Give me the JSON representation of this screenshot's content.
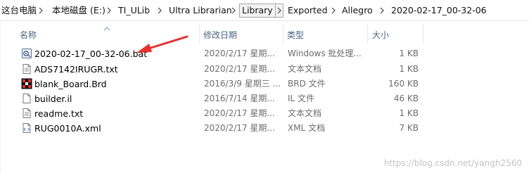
{
  "breadcrumb": [
    {
      "label": "这台电脑"
    },
    {
      "label": "本地磁盘 (E:)"
    },
    {
      "label": "TI_ULib"
    },
    {
      "label": "Ultra Librarian"
    },
    {
      "label": "Library"
    },
    {
      "label": "Exported"
    },
    {
      "label": "Allegro"
    },
    {
      "label": "2020-02-17_00-32-06"
    }
  ],
  "columns": {
    "name": "名称",
    "date": "修改日期",
    "type": "类型",
    "size": "大小"
  },
  "files": [
    {
      "name": "2020-02-17_00-32-06.bat",
      "date": "2020/2/17 星期...",
      "type": "Windows 批处理...",
      "size": "1 KB",
      "icon": "batch-file-icon"
    },
    {
      "name": "ADS7142IRUGR.txt",
      "date": "2020/2/17 星期...",
      "type": "文本文档",
      "size": "1 KB",
      "icon": "text-file-icon"
    },
    {
      "name": "blank_Board.Brd",
      "date": "2016/3/9 星期三 ...",
      "type": "BRD 文件",
      "size": "160 KB",
      "icon": "brd-file-icon"
    },
    {
      "name": "builder.il",
      "date": "2016/7/14 星期...",
      "type": "IL 文件",
      "size": "46 KB",
      "icon": "generic-file-icon"
    },
    {
      "name": "readme.txt",
      "date": "2020/2/17 星期...",
      "type": "文本文档",
      "size": "1 KB",
      "icon": "text-file-icon"
    },
    {
      "name": "RUG0010A.xml",
      "date": "2020/2/17 星期...",
      "type": "XML 文档",
      "size": "7 KB",
      "icon": "xml-file-icon"
    }
  ],
  "watermark": "https://blog.csdn.net/yangh2560",
  "colors": {
    "header_text": "#4d6082",
    "annotation_arrow": "#e8312f",
    "active_crumb_border": "#a8a8a8"
  }
}
